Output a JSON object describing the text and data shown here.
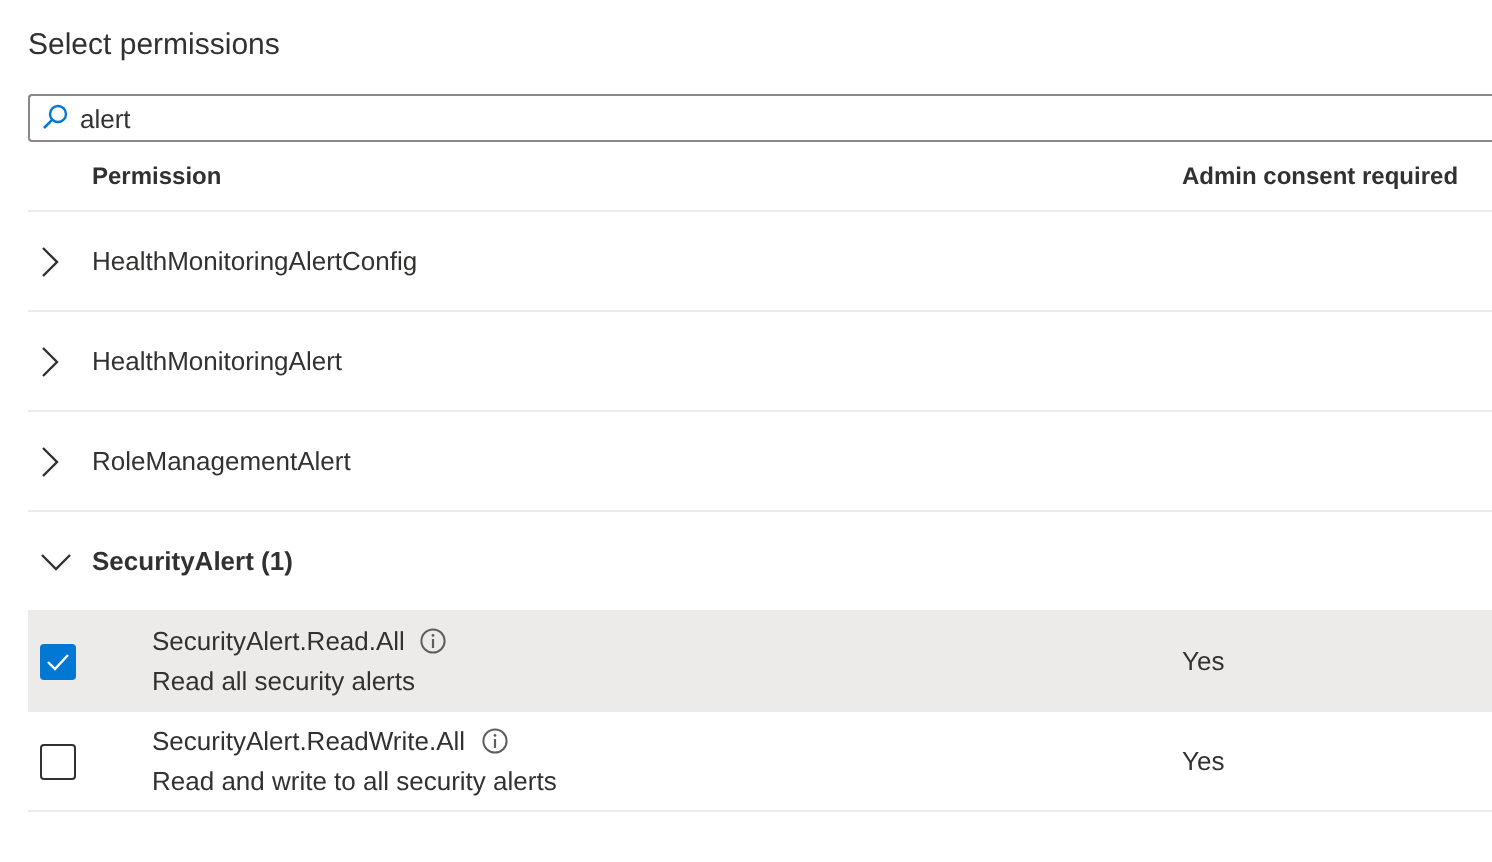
{
  "title": "Select permissions",
  "search": {
    "value": "alert"
  },
  "columns": [
    "Permission",
    "Admin consent required"
  ],
  "groups": [
    {
      "name": "HealthMonitoringAlertConfig",
      "expanded": false
    },
    {
      "name": "HealthMonitoringAlert",
      "expanded": false
    },
    {
      "name": "RoleManagementAlert",
      "expanded": false
    },
    {
      "name": "SecurityAlert (1)",
      "expanded": true,
      "permissions": [
        {
          "name": "SecurityAlert.Read.All",
          "description": "Read all security alerts",
          "admin_consent": "Yes",
          "checked": true,
          "selected": true
        },
        {
          "name": "SecurityAlert.ReadWrite.All",
          "description": "Read and write to all security alerts",
          "admin_consent": "Yes",
          "checked": false,
          "selected": false
        }
      ]
    }
  ]
}
